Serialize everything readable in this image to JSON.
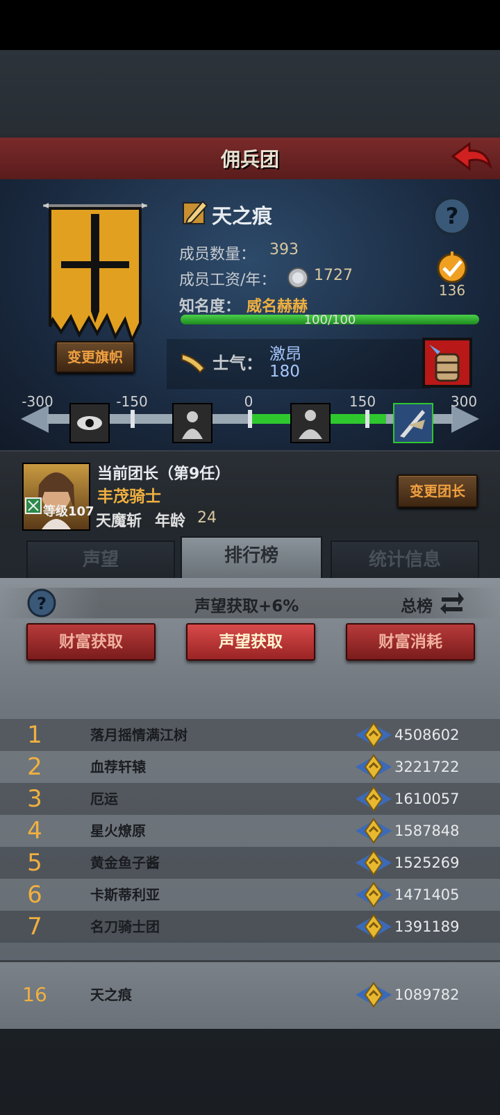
{
  "header": {
    "title": "佣兵团"
  },
  "guild": {
    "name": "天之痕",
    "members_label": "成员数量：",
    "members_value": "393",
    "salary_label": "成员工资/年：",
    "salary_value": "1727",
    "fame_label": "知名度：",
    "fame_value": "威名赫赫",
    "fame_progress_text": "100/100",
    "fame_progress": 1.0,
    "badge_value": "136",
    "change_flag_label": "变更旗帜",
    "morale_label": "士气：",
    "morale_state": "激昂",
    "morale_value": "180",
    "morale_ticks": [
      "-300",
      "-150",
      "0",
      "150",
      "300"
    ]
  },
  "leader": {
    "title": "当前团长（第9任）",
    "name": "丰茂骑士",
    "level": "等级107",
    "skill": "天魔斩",
    "age_label": "年龄",
    "age_value": "24",
    "change_label": "变更团长"
  },
  "tabs": [
    "声望",
    "排行榜",
    "统计信息"
  ],
  "active_tab": 1,
  "ranking": {
    "subtitle": "声望获取+6%",
    "total_label": "总榜",
    "buttons": [
      "财富获取",
      "声望获取",
      "财富消耗"
    ],
    "active_button": 1,
    "rows": [
      {
        "rank": "1",
        "name": "落月摇情满江树",
        "score": "4508602"
      },
      {
        "rank": "2",
        "name": "血荐轩辕",
        "score": "3221722"
      },
      {
        "rank": "3",
        "name": "厄运",
        "score": "1610057"
      },
      {
        "rank": "4",
        "name": "星火燎原",
        "score": "1587848"
      },
      {
        "rank": "5",
        "name": "黄金鱼子酱",
        "score": "1525269"
      },
      {
        "rank": "6",
        "name": "卡斯蒂利亚",
        "score": "1471405"
      },
      {
        "rank": "7",
        "name": "名刀骑士团",
        "score": "1391189"
      }
    ],
    "my_row": {
      "rank": "16",
      "name": "天之痕",
      "score": "1089782"
    }
  },
  "colors": {
    "accent_gold": "#f0b040",
    "title_red": "#7a2a2a",
    "morale_green": "#2ec82e"
  }
}
